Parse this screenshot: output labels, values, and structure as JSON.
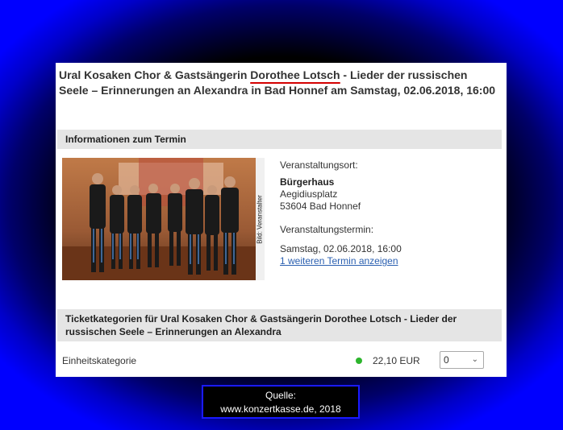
{
  "title": {
    "part1": "Ural Kosaken Chor & Gastsängerin ",
    "highlight": "Dorothee Lotsch",
    "part2": " - Lieder der russischen Seele – Erinnerungen an Alexandra in Bad Honnef am Samstag, 02.06.2018, 16:00"
  },
  "info_section": {
    "heading": "Informationen zum Termin",
    "photo_credit": "Bild: Veranstalter",
    "venue_label": "Veranstaltungsort:",
    "venue_name": "Bürgerhaus",
    "street": "Aegidiusplatz",
    "city": "53604 Bad Honnef",
    "date_label": "Veranstaltungstermin:",
    "date_value": "Samstag, 02.06.2018, 16:00",
    "more_dates_link": "1 weiteren Termin anzeigen"
  },
  "ticket_section": {
    "heading": "Ticketkategorien für Ural Kosaken Chor & Gastsängerin Dorothee Lotsch - Lieder der russischen Seele – Erinnerungen an Alexandra",
    "category": "Einheitskategorie",
    "price": "22,10 EUR",
    "quantity": "0",
    "availability_color": "#2db52d"
  },
  "source": {
    "label": "Quelle:",
    "url": "www.konzertkasse.de, 2018"
  },
  "colors": {
    "frame_blue": "#0000ff",
    "highlight_underline": "#d40000",
    "link": "#2a5fb0"
  }
}
